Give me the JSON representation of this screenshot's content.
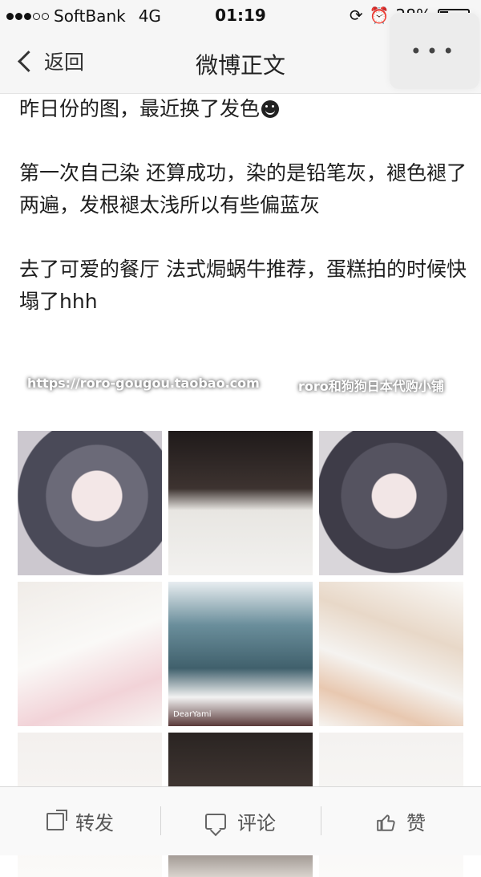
{
  "status_bar": {
    "carrier": "SoftBank",
    "network": "4G",
    "time": "01:19",
    "battery_percent": "28%",
    "battery_level": 0.28,
    "signal_bars_filled": 3,
    "signal_bars_total": 5
  },
  "nav": {
    "back_label": "返回",
    "title": "微博正文",
    "more_label": "•••"
  },
  "post": {
    "paragraphs": [
      "昨日份的图，最近换了发色",
      "第一次自己染 还算成功，染的是铅笔灰，褪色褪了两遍，发根褪太浅所以有些偏蓝灰",
      "去了可爱的餐厅 法式焗蜗牛推荐，蛋糕拍的时候快塌了hhh"
    ],
    "watermark_url": "https://roro-gougou.taobao.com",
    "watermark_shop": "roro和狗狗日本代购小铺",
    "photo_caption": "DearYami"
  },
  "toolbar": {
    "repost_label": "转发",
    "comment_label": "评论",
    "like_label": "赞"
  },
  "icons": {
    "back": "chevron-left-icon",
    "more": "more-icon",
    "repost": "share-icon",
    "comment": "comment-icon",
    "like": "thumbs-up-icon",
    "emoji": "smile-emoji-icon"
  }
}
